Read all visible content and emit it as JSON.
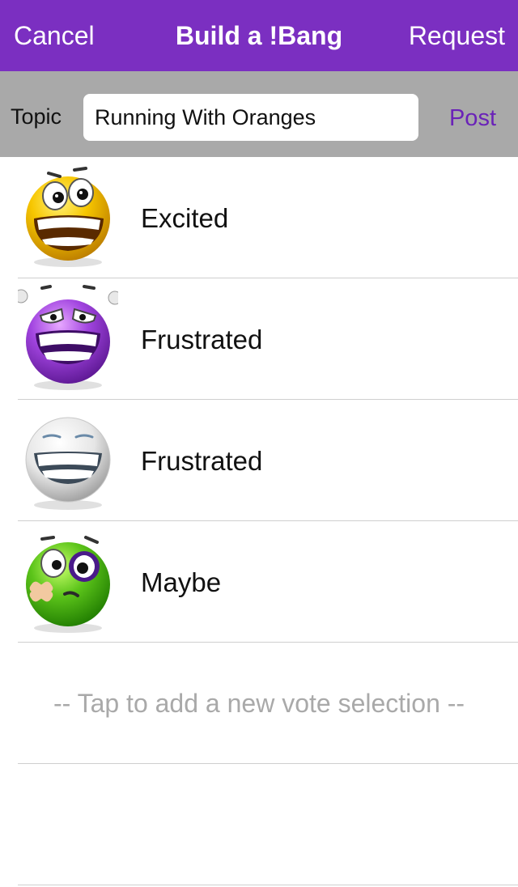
{
  "navbar": {
    "cancel_label": "Cancel",
    "title": "Build a !Bang",
    "request_label": "Request",
    "background": "#7b2fc1"
  },
  "topic": {
    "label": "Topic",
    "value": "Running With Oranges",
    "post_label": "Post"
  },
  "selections": [
    {
      "label": "Excited",
      "icon": "excited-yellow-emoji-icon",
      "color": "#f5c400"
    },
    {
      "label": "Frustrated",
      "icon": "frustrated-purple-emoji-icon",
      "color": "#9b3fd6"
    },
    {
      "label": "Frustrated",
      "icon": "grinning-white-emoji-icon",
      "color": "#e8e8e8"
    },
    {
      "label": "Maybe",
      "icon": "bruised-green-emoji-icon",
      "color": "#5bc41a"
    }
  ],
  "add_selection_label": "-- Tap to add a new vote selection --"
}
